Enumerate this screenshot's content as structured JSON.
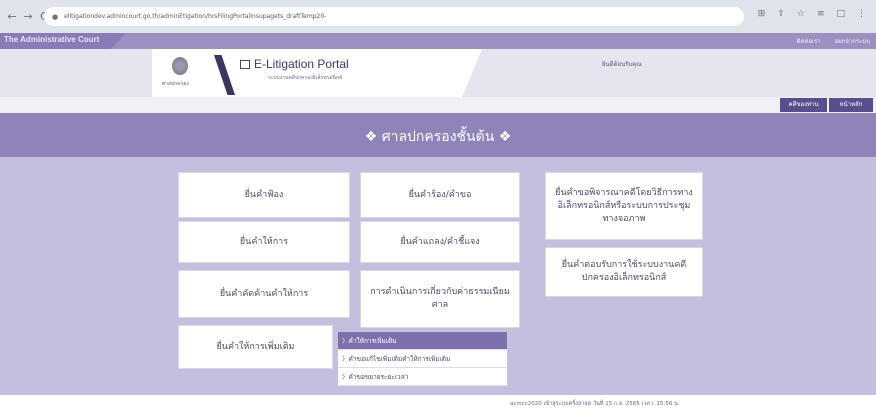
{
  "browser": {
    "url": "elitigationdev.admincourt.go.th/adminEtigation/hrsFilingPortalInsupagets_draftTemp20-",
    "back_icon": "←",
    "forward_icon": "→",
    "reload_icon": "C",
    "icons": [
      "⊞",
      "⇪",
      "☆",
      "≡",
      "□",
      "⋮"
    ]
  },
  "top_strip": {
    "brand": "The Administrative Court",
    "link_contact": "ติดต่อเรา",
    "link_print": "ออกจากระบบ"
  },
  "header": {
    "emblem_label": "ศาลปกครอง",
    "portal_title": "E-Litigation Portal",
    "portal_subtitle": "ระบบงานคดีปกครองอิเล็กทรอนิกส์",
    "welcome": "ยินดีต้อนรับคุณ"
  },
  "buttons": {
    "back": "คดีของท่าน",
    "home": "หน้าหลัก"
  },
  "banner": {
    "title": "❖ ศาลปกครองชั้นต้น ❖"
  },
  "cards": {
    "file_complaint": "ยื่นคำฟ้อง",
    "file_request": "ยื่นคำร้อง/คำขอ",
    "file_consider": "ยื่นคำขอพิจารณาคดีโดยวิธีการทางอิเล็กทรอนิกส์หรือระบบการประชุมทางจอภาพ",
    "file_testimony": "ยื่นคำให้การ",
    "file_statement": "ยื่นคำแถลง/คำชี้แจง",
    "file_response": "ยื่นคำตอบรับการใช้ระบบงานคดีปกครองอิเล็กทรอนิกส์",
    "file_objection": "ยื่นคำคัดค้านคำให้การ",
    "fee_process": "การดำเนินการเกี่ยวกับค่าธรรมเนียมศาล",
    "file_additional": "ยื่นคำให้การเพิ่มเติม"
  },
  "dropdown": {
    "items": [
      "〉คำให้การเพิ่มเติม",
      "〉คำขอแก้ไขเพิ่มเติมคำให้การเพิ่มเติม",
      "〉คำขอขยายระยะเวลา"
    ]
  },
  "footer": {
    "text": "acmcc2020 เข้าสู่ระบบครั้งล่าสุด วันที่ 15 ก.ย. 2565 เวลา: 15:56 น."
  }
}
